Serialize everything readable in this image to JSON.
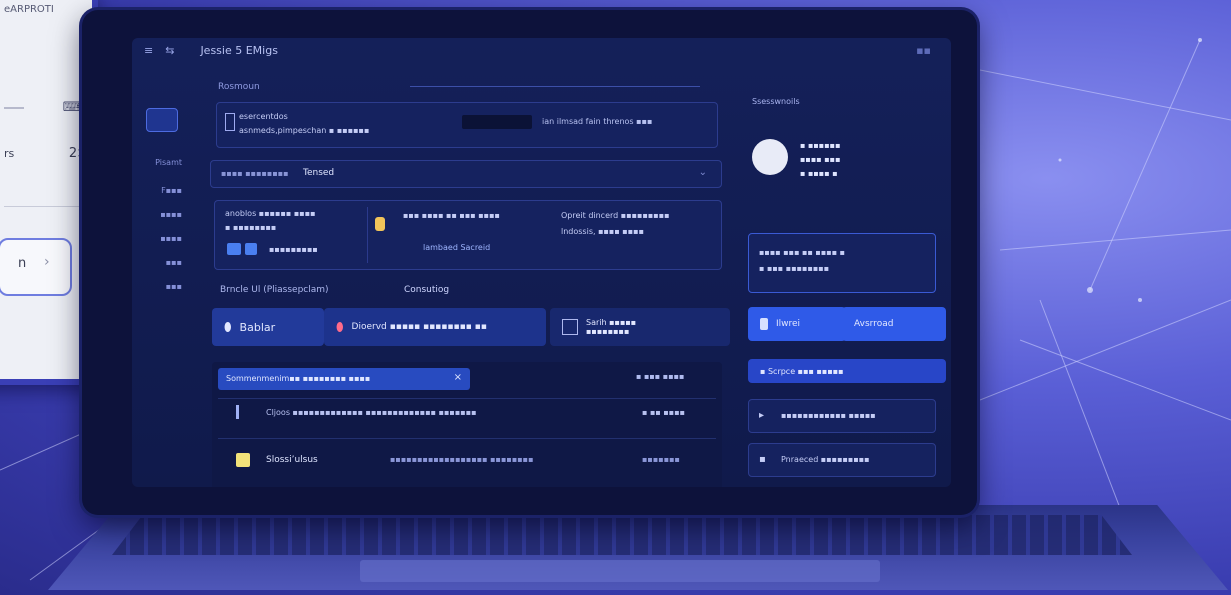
{
  "card": {
    "header_text": "eARPROTI",
    "row1_icon": "keyboard-icon",
    "row2_label": "rs",
    "row2_value": "2>",
    "pill_label": "n",
    "pill_arrow": "›"
  },
  "window": {
    "title_controls": [
      "≡",
      "⇆"
    ],
    "title": "Jessie 5 EMigs",
    "tab_hint": "▪▪"
  },
  "sidebar": {
    "items": [
      "Pisamt",
      "F▪▪▪",
      "▪▪▪▪",
      "▪▪▪▪",
      "▪▪▪",
      "▪▪▪"
    ]
  },
  "main": {
    "section_label": "Rosmoun",
    "top_panel_line1": "esercentdos",
    "top_panel_line2": "asnmeds,pimpeschan ▪ ▪▪▪▪▪▪",
    "top_panel_right": "ian  ilmsad  fain  threnos   ▪▪▪",
    "search_prefix": "▪▪▪▪ ▪▪▪▪▪▪▪▪",
    "search_value": "Tensed",
    "card_a_line1": "anoblos  ▪▪▪▪▪▪ ▪▪▪▪",
    "card_a_line2": "▪  ▪▪▪▪▪▪▪▪",
    "card_a_line3": "▪▪▪▪▪▪▪▪▪",
    "card_b_line1": "▪▪▪ ▪▪▪▪ ▪▪ ▪▪▪ ▪▪▪▪",
    "card_b_button": "lambaed Sacreid",
    "card_c_line1": "Opreit dincerd ▪▪▪▪▪▪▪▪▪",
    "card_c_line2": "lndossis,  ▪▪▪▪  ▪▪▪▪",
    "subsection_label": "Brncle Ul (Pliassepclam)",
    "subsection_value": "Consutiog",
    "btn_1": "Bablar",
    "btn_2": "Dioervd ▪▪▪▪▪ ▪▪▪▪▪▪▪▪ ▪▪",
    "btn_3_line1": "Sarih ▪▪▪▪▪",
    "btn_3_line2": "▪▪▪▪▪▪▪▪",
    "filter_label": "Sommenmenim▪▪ ▪▪▪▪▪▪▪▪ ▪▪▪▪",
    "filter_right": "▪ ▪▪▪  ▪▪▪▪",
    "row1_text": "Cljoos ▪▪▪▪▪▪▪▪▪▪▪▪▪   ▪▪▪▪▪▪▪▪▪▪▪▪▪ ▪▪▪▪▪▪▪",
    "row1_right": "▪ ▪▪ ▪▪▪▪",
    "row2_label": "Slossi’ulsus",
    "row2_text": "▪▪▪▪▪▪▪▪▪▪▪▪▪▪▪▪▪▪ ▪▪▪▪▪▪▪▪",
    "row2_right": "▪▪▪▪▪▪▪"
  },
  "right": {
    "header": "Ssesswnoils",
    "profile_line1": "▪ ▪▪▪▪▪▪",
    "profile_line2": "▪▪▪▪ ▪▪▪",
    "profile_line3": "▪ ▪▪▪▪ ▪",
    "info_line1": "▪▪▪▪ ▪▪▪ ▪▪ ▪▪▪▪ ▪",
    "info_line2": "▪ ▪▪▪ ▪▪▪▪▪▪▪▪",
    "btn_left": "Ilwrei",
    "btn_right": "Avsrroad",
    "wide_button": "▪  Scrpce ▪▪▪ ▪▪▪▪▪",
    "item1": "▪▪▪▪▪▪▪▪▪▪▪▪  ▪▪▪▪▪",
    "item2": "Pnraeced ▪▪▪▪▪▪▪▪▪",
    "footer": "▪▪▪▪▪  ▪▪▪▪▪▪"
  },
  "colors": {
    "accent": "#2f5ae8",
    "screen_bg": "#121c50",
    "background": "#5a5fd6"
  }
}
